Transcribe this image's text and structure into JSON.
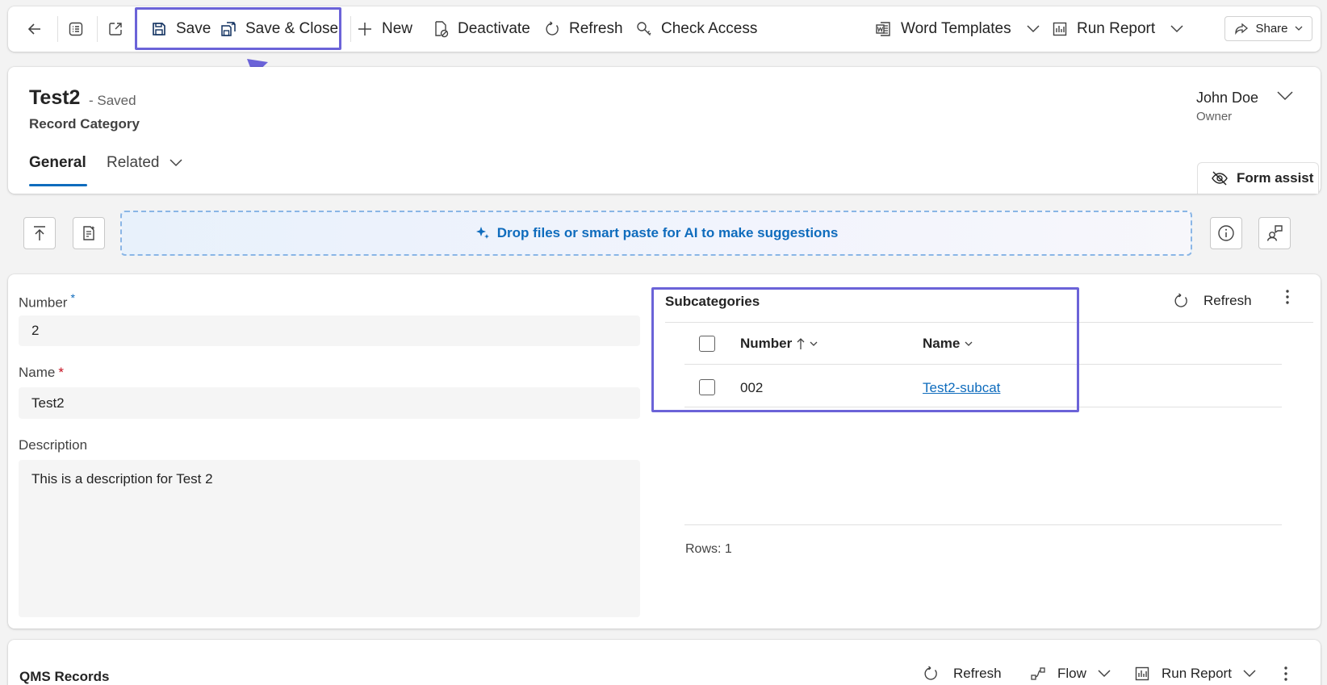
{
  "toolbar": {
    "save": "Save",
    "save_close": "Save & Close",
    "new": "New",
    "deactivate": "Deactivate",
    "refresh": "Refresh",
    "check_access": "Check Access",
    "word_templates": "Word Templates",
    "run_report": "Run Report",
    "share": "Share"
  },
  "header": {
    "title": "Test2",
    "status": "- Saved",
    "entity": "Record Category",
    "owner_name": "John Doe",
    "owner_label": "Owner",
    "tabs": {
      "general": "General",
      "related": "Related"
    },
    "form_assist": "Form assist"
  },
  "ai_bar": {
    "text": "Drop files or smart paste for AI to make suggestions"
  },
  "form": {
    "number_label": "Number",
    "number_value": "2",
    "name_label": "Name",
    "name_value": "Test2",
    "description_label": "Description",
    "description_value": "This is a description for Test 2",
    "required_mark": "*"
  },
  "subgrid": {
    "title": "Subcategories",
    "refresh": "Refresh",
    "columns": {
      "number": "Number",
      "name": "Name"
    },
    "rows": [
      {
        "number": "002",
        "name": "Test2-subcat"
      }
    ],
    "rows_count": "Rows: 1"
  },
  "qms": {
    "title": "QMS Records",
    "refresh": "Refresh",
    "flow": "Flow",
    "run_report": "Run Report"
  },
  "colors": {
    "accent": "#0f6cbd",
    "highlight": "#6b63d8",
    "required": "#c50f1f"
  }
}
